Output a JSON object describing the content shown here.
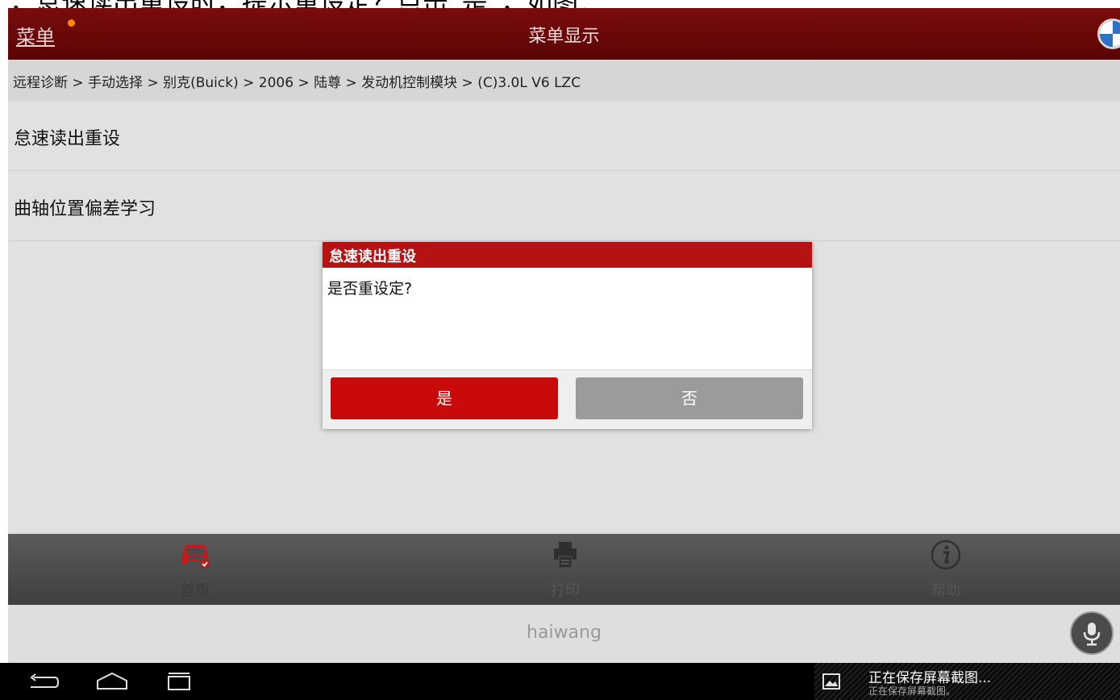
{
  "caption_text": "，怠速读出重设时，提示重设定？点击“是”，如图：",
  "titlebar": {
    "menu_label": "菜单",
    "title": "菜单显示",
    "brand_icon": "bmw-logo-icon"
  },
  "breadcrumb": "远程诊断  > 手动选择 > 别克(Buick) > 2006 > 陆尊 > 发动机控制模块 > (C)3.0L V6 LZC",
  "menu_items": [
    {
      "label": "怠速读出重设"
    },
    {
      "label": "曲轴位置偏差学习"
    }
  ],
  "dialog": {
    "title": "怠速读出重设",
    "message": "是否重设定?",
    "yes_label": "是",
    "no_label": "否"
  },
  "toolbar": {
    "home_label": "首页",
    "print_label": "打印",
    "help_label": "帮助"
  },
  "namebar": {
    "username": "haiwang"
  },
  "notification": {
    "title": "正在保存屏幕截图...",
    "subtitle": "正在保存屏幕截图。"
  },
  "colors": {
    "titlebar": "#6b0909",
    "accent_red": "#c90a0a",
    "dialog_header": "#b51313",
    "button_gray": "#9b9b9b"
  }
}
